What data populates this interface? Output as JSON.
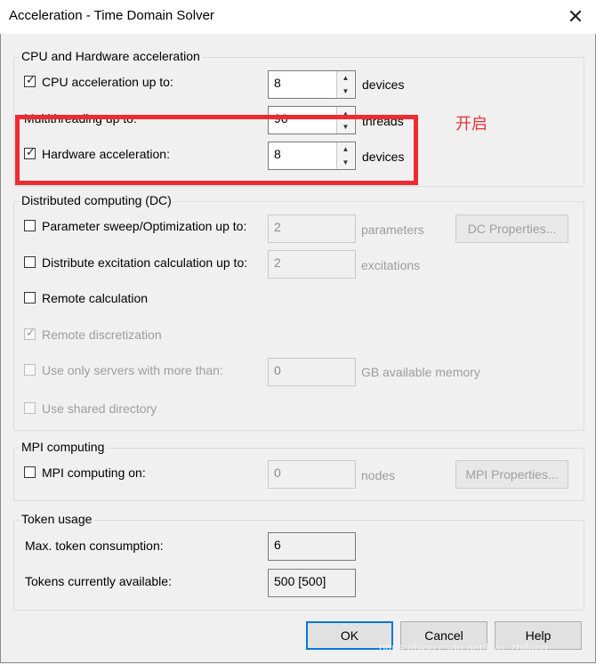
{
  "window": {
    "title": "Acceleration - Time Domain Solver",
    "close_glyph": "✕"
  },
  "cpu_group": {
    "legend": "CPU and Hardware acceleration",
    "cpu_accel": {
      "label": "CPU acceleration up to:",
      "checked": true,
      "value": "8",
      "unit": "devices"
    },
    "multithreading": {
      "label": "Multithreading up to:",
      "value": "96",
      "unit": "threads"
    },
    "hardware_accel": {
      "label": "Hardware acceleration:",
      "checked": true,
      "value": "8",
      "unit": "devices"
    }
  },
  "annotation": {
    "text": "开启",
    "color": "#ee2b31"
  },
  "dc_group": {
    "legend": "Distributed computing (DC)",
    "param_sweep": {
      "label": "Parameter sweep/Optimization up to:",
      "value": "2",
      "unit": "parameters"
    },
    "dc_properties": "DC Properties...",
    "distribute_exc": {
      "label": "Distribute excitation calculation up to:",
      "value": "2",
      "unit": "excitations"
    },
    "remote_calc": {
      "label": "Remote calculation"
    },
    "remote_disc": {
      "label": "Remote discretization"
    },
    "servers": {
      "label": "Use only servers with more than:",
      "value": "0",
      "unit": "GB available memory"
    },
    "shared_dir": {
      "label": "Use shared directory"
    }
  },
  "mpi_group": {
    "legend": "MPI computing",
    "mpi_on": {
      "label": "MPI computing on:",
      "value": "0",
      "unit": "nodes"
    },
    "mpi_properties": "MPI Properties..."
  },
  "token_group": {
    "legend": "Token usage",
    "max_label": "Max. token consumption:",
    "max_value": "6",
    "available_label": "Tokens currently available:",
    "available_value": "500 [500]"
  },
  "buttons": {
    "ok": "OK",
    "cancel": "Cancel",
    "help": "Help"
  },
  "watermark": "https://blog.csdn.net/Lyu_zhifang"
}
